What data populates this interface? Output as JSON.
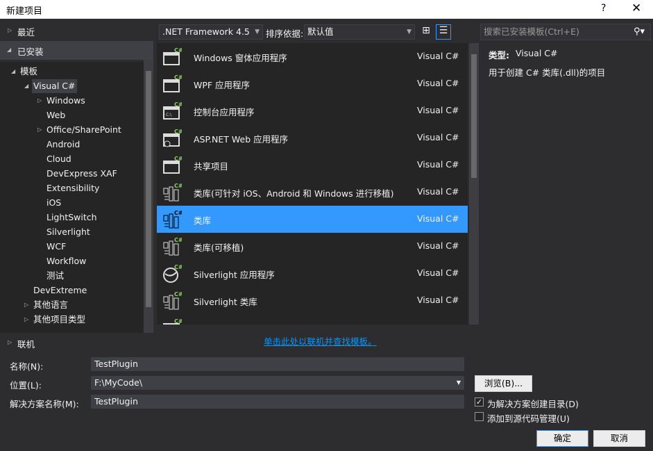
{
  "window": {
    "title": "新建项目",
    "help": "?",
    "close": "✕"
  },
  "tree": {
    "recent": "最近",
    "installed": "已安装",
    "online": "联机",
    "items": [
      {
        "label": "模板",
        "level": 1,
        "arrow": "expanded"
      },
      {
        "label": "Visual C#",
        "level": 2,
        "arrow": "expanded",
        "selected": true
      },
      {
        "label": "Windows",
        "level": 3,
        "arrow": "collapsed"
      },
      {
        "label": "Web",
        "level": 3
      },
      {
        "label": "Office/SharePoint",
        "level": 3,
        "arrow": "collapsed"
      },
      {
        "label": "Android",
        "level": 3
      },
      {
        "label": "Cloud",
        "level": 3
      },
      {
        "label": "DevExpress XAF",
        "level": 3
      },
      {
        "label": "Extensibility",
        "level": 3
      },
      {
        "label": "iOS",
        "level": 3
      },
      {
        "label": "LightSwitch",
        "level": 3
      },
      {
        "label": "Silverlight",
        "level": 3
      },
      {
        "label": "WCF",
        "level": 3
      },
      {
        "label": "Workflow",
        "level": 3
      },
      {
        "label": "测试",
        "level": 3
      },
      {
        "label": "DevExtreme",
        "level": 2
      },
      {
        "label": "其他语言",
        "level": 2,
        "arrow": "collapsed"
      },
      {
        "label": "其他项目类型",
        "level": 2,
        "arrow": "collapsed"
      }
    ]
  },
  "toolbar": {
    "framework": ".NET Framework 4.5",
    "sort_label": "排序依据:",
    "sort_value": "默认值",
    "search_placeholder": "搜索已安装模板(Ctrl+E)"
  },
  "templates": [
    {
      "name": "Windows 窗体应用程序",
      "lang": "Visual C#",
      "icon": "winforms-icon"
    },
    {
      "name": "WPF 应用程序",
      "lang": "Visual C#",
      "icon": "wpf-icon"
    },
    {
      "name": "控制台应用程序",
      "lang": "Visual C#",
      "icon": "console-icon"
    },
    {
      "name": "ASP.NET Web 应用程序",
      "lang": "Visual C#",
      "icon": "web-icon"
    },
    {
      "name": "共享项目",
      "lang": "Visual C#",
      "icon": "shared-icon"
    },
    {
      "name": "类库(可针对 iOS、Android 和 Windows 进行移植)",
      "lang": "Visual C#",
      "icon": "library-icon"
    },
    {
      "name": "类库",
      "lang": "Visual C#",
      "icon": "library-icon",
      "selected": true
    },
    {
      "name": "类库(可移植)",
      "lang": "Visual C#",
      "icon": "library-icon"
    },
    {
      "name": "Silverlight 应用程序",
      "lang": "Visual C#",
      "icon": "silverlight-icon"
    },
    {
      "name": "Silverlight 类库",
      "lang": "Visual C#",
      "icon": "silverlight-library-icon"
    }
  ],
  "details": {
    "type_label": "类型:",
    "type_value": "Visual C#",
    "description": "用于创建 C# 类库(.dll)的项目"
  },
  "online_link": "单击此处以联机并查找模板。",
  "form": {
    "name_label": "名称(N):",
    "name_value": "TestPlugin",
    "location_label": "位置(L):",
    "location_value": "F:\\MyCode\\",
    "solution_label": "解决方案名称(M):",
    "solution_value": "TestPlugin",
    "browse": "浏览(B)...",
    "create_dir": "为解决方案创建目录(D)",
    "create_dir_checked": true,
    "source_control": "添加到源代码管理(U)",
    "source_control_checked": false,
    "ok": "确定",
    "cancel": "取消"
  },
  "colors": {
    "selection": "#3399ff",
    "link": "#0097fb",
    "csharp": "#8bd45f"
  }
}
